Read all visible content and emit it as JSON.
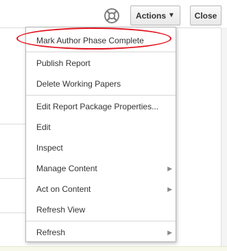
{
  "toolbar": {
    "help_icon": "help-lifebuoy-icon",
    "actions_label": "Actions",
    "actions_caret_icon": "caret-down-icon",
    "close_label": "Close"
  },
  "menu": {
    "highlight_color": "#e3101c",
    "items": [
      {
        "label": "Mark Author Phase Complete",
        "submenu": false
      },
      {
        "label": "Publish Report",
        "submenu": false
      },
      {
        "label": "Delete Working Papers",
        "submenu": false
      },
      {
        "label": "Edit Report Package Properties...",
        "submenu": false
      },
      {
        "label": "Edit",
        "submenu": false
      },
      {
        "label": "Inspect",
        "submenu": false
      },
      {
        "label": "Manage Content",
        "submenu": true
      },
      {
        "label": "Act on Content",
        "submenu": true
      },
      {
        "label": "Refresh View",
        "submenu": false
      },
      {
        "label": "Refresh",
        "submenu": true
      }
    ]
  }
}
